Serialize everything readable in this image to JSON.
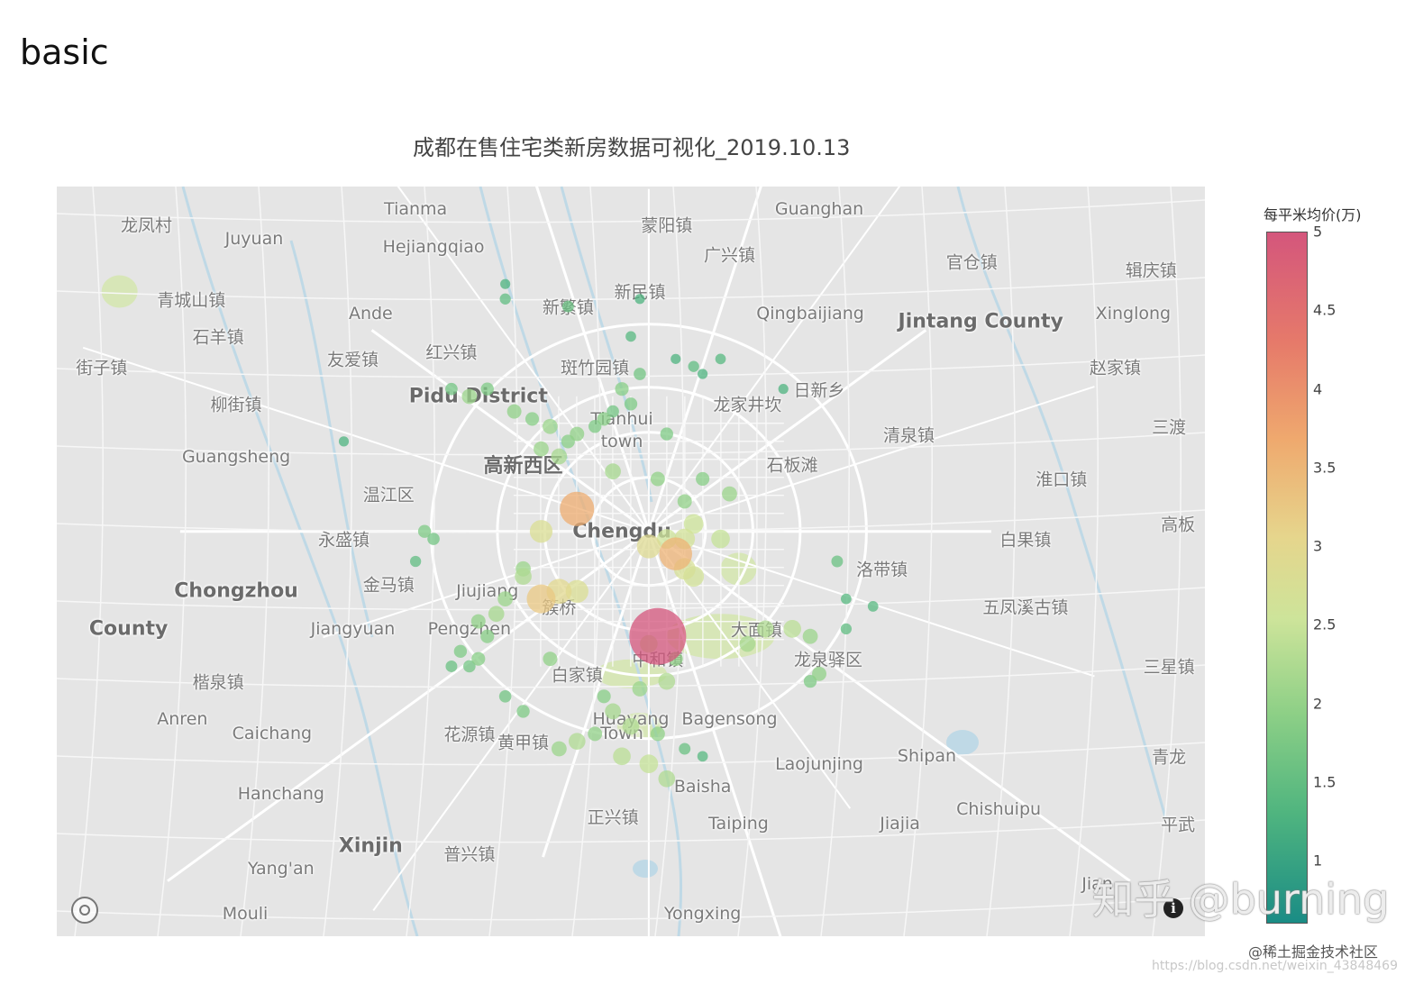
{
  "heading": "basic",
  "title": "成都在售住宅类新房数据可视化_2019.10.13",
  "colorbar": {
    "title": "每平米均价(万)",
    "ticks": [
      "5",
      "4.5",
      "4",
      "3.5",
      "3",
      "2.5",
      "2",
      "1.5",
      "1"
    ],
    "range": [
      0.6,
      5
    ],
    "colors": [
      "#1a8c85",
      "#50b57f",
      "#8ccf86",
      "#cde49a",
      "#e6d58c",
      "#efa96e",
      "#e67a6a",
      "#d4567c"
    ]
  },
  "places": [
    {
      "name": "Tianma",
      "lon": 103.8,
      "lat": 31.0
    },
    {
      "name": "Guanghan",
      "lon": 104.25,
      "lat": 31.0
    },
    {
      "name": "龙凤村",
      "lon": 103.5,
      "lat": 30.98
    },
    {
      "name": "Juyuan",
      "lon": 103.62,
      "lat": 30.96
    },
    {
      "name": "Hejiangqiao",
      "lon": 103.82,
      "lat": 30.95
    },
    {
      "name": "蒙阳镇",
      "lon": 104.08,
      "lat": 30.98
    },
    {
      "name": "广兴镇",
      "lon": 104.15,
      "lat": 30.94
    },
    {
      "name": "官仓镇",
      "lon": 104.42,
      "lat": 30.93
    },
    {
      "name": "辑庆镇",
      "lon": 104.62,
      "lat": 30.92
    },
    {
      "name": "青城山镇",
      "lon": 103.55,
      "lat": 30.88
    },
    {
      "name": "新民镇",
      "lon": 104.05,
      "lat": 30.89
    },
    {
      "name": "新繁镇",
      "lon": 103.97,
      "lat": 30.87
    },
    {
      "name": "Ande",
      "lon": 103.75,
      "lat": 30.86
    },
    {
      "name": "Qingbaijiang",
      "lon": 104.24,
      "lat": 30.86
    },
    {
      "name": "Jintang County",
      "lon": 104.43,
      "lat": 30.85,
      "major": true
    },
    {
      "name": "Xinglong",
      "lon": 104.6,
      "lat": 30.86
    },
    {
      "name": "石羊镇",
      "lon": 103.58,
      "lat": 30.83
    },
    {
      "name": "友爱镇",
      "lon": 103.73,
      "lat": 30.8
    },
    {
      "name": "红兴镇",
      "lon": 103.84,
      "lat": 30.81
    },
    {
      "name": "斑竹园镇",
      "lon": 104.0,
      "lat": 30.79
    },
    {
      "name": "街子镇",
      "lon": 103.45,
      "lat": 30.79
    },
    {
      "name": "赵家镇",
      "lon": 104.58,
      "lat": 30.79
    },
    {
      "name": "Pidu District",
      "lon": 103.87,
      "lat": 30.75,
      "major": true
    },
    {
      "name": "日新乡",
      "lon": 104.25,
      "lat": 30.76
    },
    {
      "name": "柳街镇",
      "lon": 103.6,
      "lat": 30.74
    },
    {
      "name": "龙家井坎",
      "lon": 104.17,
      "lat": 30.74
    },
    {
      "name": "Tianhui",
      "lon": 104.03,
      "lat": 30.72
    },
    {
      "name": "town",
      "lon": 104.03,
      "lat": 30.69
    },
    {
      "name": "清泉镇",
      "lon": 104.35,
      "lat": 30.7
    },
    {
      "name": "三渡",
      "lon": 104.64,
      "lat": 30.71
    },
    {
      "name": "Guangsheng",
      "lon": 103.6,
      "lat": 30.67
    },
    {
      "name": "高新西区",
      "lon": 103.92,
      "lat": 30.66,
      "major": true
    },
    {
      "name": "石板滩",
      "lon": 104.22,
      "lat": 30.66
    },
    {
      "name": "淮口镇",
      "lon": 104.52,
      "lat": 30.64
    },
    {
      "name": "温江区",
      "lon": 103.77,
      "lat": 30.62
    },
    {
      "name": "Chengdu",
      "lon": 104.03,
      "lat": 30.57,
      "major": true
    },
    {
      "name": "高板",
      "lon": 104.65,
      "lat": 30.58
    },
    {
      "name": "永盛镇",
      "lon": 103.72,
      "lat": 30.56
    },
    {
      "name": "白果镇",
      "lon": 104.48,
      "lat": 30.56
    },
    {
      "name": "洛带镇",
      "lon": 104.32,
      "lat": 30.52
    },
    {
      "name": "金马镇",
      "lon": 103.77,
      "lat": 30.5
    },
    {
      "name": "Chongzhou",
      "lon": 103.6,
      "lat": 30.49,
      "major": true
    },
    {
      "name": "Jiujiang",
      "lon": 103.88,
      "lat": 30.49
    },
    {
      "name": "簇桥",
      "lon": 103.96,
      "lat": 30.47
    },
    {
      "name": "五凤溪古镇",
      "lon": 104.48,
      "lat": 30.47
    },
    {
      "name": "County",
      "lon": 103.48,
      "lat": 30.44,
      "major": true
    },
    {
      "name": "Jiangyuan",
      "lon": 103.73,
      "lat": 30.44
    },
    {
      "name": "Pengzhen",
      "lon": 103.86,
      "lat": 30.44
    },
    {
      "name": "大面镇",
      "lon": 104.18,
      "lat": 30.44
    },
    {
      "name": "中和镇",
      "lon": 104.07,
      "lat": 30.4
    },
    {
      "name": "龙泉驿区",
      "lon": 104.26,
      "lat": 30.4
    },
    {
      "name": "白家镇",
      "lon": 103.98,
      "lat": 30.38
    },
    {
      "name": "三星镇",
      "lon": 104.64,
      "lat": 30.39
    },
    {
      "name": "楷泉镇",
      "lon": 103.58,
      "lat": 30.37
    },
    {
      "name": "Anren",
      "lon": 103.54,
      "lat": 30.32
    },
    {
      "name": "Caichang",
      "lon": 103.64,
      "lat": 30.3
    },
    {
      "name": "Huayang",
      "lon": 104.04,
      "lat": 30.32
    },
    {
      "name": "Bagensong",
      "lon": 104.15,
      "lat": 30.32
    },
    {
      "name": "花源镇",
      "lon": 103.86,
      "lat": 30.3
    },
    {
      "name": "黄甲镇",
      "lon": 103.92,
      "lat": 30.29
    },
    {
      "name": "Town",
      "lon": 104.03,
      "lat": 30.3
    },
    {
      "name": "青龙",
      "lon": 104.64,
      "lat": 30.27
    },
    {
      "name": "Laojunjing",
      "lon": 104.25,
      "lat": 30.26
    },
    {
      "name": "Shipan",
      "lon": 104.37,
      "lat": 30.27
    },
    {
      "name": "Baisha",
      "lon": 104.12,
      "lat": 30.23
    },
    {
      "name": "Hanchang",
      "lon": 103.65,
      "lat": 30.22
    },
    {
      "name": "Chishuipu",
      "lon": 104.45,
      "lat": 30.2
    },
    {
      "name": "正兴镇",
      "lon": 104.02,
      "lat": 30.19
    },
    {
      "name": "Taiping",
      "lon": 104.16,
      "lat": 30.18
    },
    {
      "name": "Jiajia",
      "lon": 104.34,
      "lat": 30.18
    },
    {
      "name": "平武",
      "lon": 104.65,
      "lat": 30.18
    },
    {
      "name": "Xinjin",
      "lon": 103.75,
      "lat": 30.15,
      "major": true
    },
    {
      "name": "普兴镇",
      "lon": 103.86,
      "lat": 30.14
    },
    {
      "name": "Yang'an",
      "lon": 103.65,
      "lat": 30.12
    },
    {
      "name": "Jian",
      "lon": 104.56,
      "lat": 30.1
    },
    {
      "name": "Mouli",
      "lon": 103.61,
      "lat": 30.06
    },
    {
      "name": "Yongxing",
      "lon": 104.12,
      "lat": 30.06
    }
  ],
  "chart_data": {
    "type": "scatter",
    "subtype": "scatter_mapbox",
    "title": "成都在售住宅类新房数据可视化_2019.10.13",
    "colorbar_title": "每平米均价(万)",
    "color_range": [
      0.6,
      5
    ],
    "lon_range": [
      103.4,
      104.68
    ],
    "lat_range": [
      30.03,
      31.03
    ],
    "points": [
      {
        "lon": 104.07,
        "lat": 30.43,
        "price": 5.0
      },
      {
        "lon": 103.9,
        "lat": 30.9,
        "price": 1.2
      },
      {
        "lon": 103.9,
        "lat": 30.88,
        "price": 1.4
      },
      {
        "lon": 104.05,
        "lat": 30.88,
        "price": 1.2
      },
      {
        "lon": 103.97,
        "lat": 30.87,
        "price": 1.5
      },
      {
        "lon": 104.04,
        "lat": 30.83,
        "price": 1.3
      },
      {
        "lon": 104.09,
        "lat": 30.8,
        "price": 1.2
      },
      {
        "lon": 104.11,
        "lat": 30.79,
        "price": 1.4
      },
      {
        "lon": 104.14,
        "lat": 30.8,
        "price": 1.3
      },
      {
        "lon": 104.12,
        "lat": 30.78,
        "price": 1.2
      },
      {
        "lon": 104.21,
        "lat": 30.76,
        "price": 1.2
      },
      {
        "lon": 104.05,
        "lat": 30.78,
        "price": 1.6
      },
      {
        "lon": 104.03,
        "lat": 30.76,
        "price": 1.8
      },
      {
        "lon": 104.04,
        "lat": 30.74,
        "price": 1.7
      },
      {
        "lon": 104.02,
        "lat": 30.73,
        "price": 1.6
      },
      {
        "lon": 104.01,
        "lat": 30.72,
        "price": 1.8
      },
      {
        "lon": 104.0,
        "lat": 30.71,
        "price": 1.7
      },
      {
        "lon": 103.98,
        "lat": 30.7,
        "price": 1.9
      },
      {
        "lon": 103.97,
        "lat": 30.69,
        "price": 1.8
      },
      {
        "lon": 104.08,
        "lat": 30.7,
        "price": 1.7
      },
      {
        "lon": 103.84,
        "lat": 30.76,
        "price": 1.6
      },
      {
        "lon": 103.88,
        "lat": 30.76,
        "price": 1.7
      },
      {
        "lon": 103.86,
        "lat": 30.75,
        "price": 2.0
      },
      {
        "lon": 103.91,
        "lat": 30.73,
        "price": 1.9
      },
      {
        "lon": 103.93,
        "lat": 30.72,
        "price": 1.8
      },
      {
        "lon": 103.95,
        "lat": 30.71,
        "price": 2.0
      },
      {
        "lon": 103.94,
        "lat": 30.68,
        "price": 2.0
      },
      {
        "lon": 103.96,
        "lat": 30.67,
        "price": 2.1
      },
      {
        "lon": 103.72,
        "lat": 30.69,
        "price": 1.2
      },
      {
        "lon": 104.02,
        "lat": 30.65,
        "price": 2.1
      },
      {
        "lon": 104.07,
        "lat": 30.64,
        "price": 1.9
      },
      {
        "lon": 104.12,
        "lat": 30.64,
        "price": 1.8
      },
      {
        "lon": 104.1,
        "lat": 30.61,
        "price": 1.9
      },
      {
        "lon": 104.15,
        "lat": 30.62,
        "price": 2.0
      },
      {
        "lon": 103.98,
        "lat": 30.6,
        "price": 3.7
      },
      {
        "lon": 103.94,
        "lat": 30.57,
        "price": 2.8
      },
      {
        "lon": 104.1,
        "lat": 30.56,
        "price": 2.6
      },
      {
        "lon": 104.11,
        "lat": 30.58,
        "price": 2.5
      },
      {
        "lon": 104.08,
        "lat": 30.56,
        "price": 2.5
      },
      {
        "lon": 104.09,
        "lat": 30.54,
        "price": 3.6
      },
      {
        "lon": 104.06,
        "lat": 30.55,
        "price": 2.9
      },
      {
        "lon": 104.14,
        "lat": 30.56,
        "price": 2.4
      },
      {
        "lon": 104.1,
        "lat": 30.52,
        "price": 2.7
      },
      {
        "lon": 104.11,
        "lat": 30.51,
        "price": 2.6
      },
      {
        "lon": 103.94,
        "lat": 30.48,
        "price": 3.3
      },
      {
        "lon": 103.96,
        "lat": 30.49,
        "price": 3.0
      },
      {
        "lon": 103.98,
        "lat": 30.49,
        "price": 2.8
      },
      {
        "lon": 103.92,
        "lat": 30.51,
        "price": 2.2
      },
      {
        "lon": 103.9,
        "lat": 30.48,
        "price": 2.0
      },
      {
        "lon": 103.89,
        "lat": 30.46,
        "price": 2.1
      },
      {
        "lon": 103.87,
        "lat": 30.45,
        "price": 1.9
      },
      {
        "lon": 103.88,
        "lat": 30.43,
        "price": 1.8
      },
      {
        "lon": 103.85,
        "lat": 30.41,
        "price": 1.7
      },
      {
        "lon": 103.87,
        "lat": 30.4,
        "price": 1.8
      },
      {
        "lon": 103.86,
        "lat": 30.39,
        "price": 1.6
      },
      {
        "lon": 103.84,
        "lat": 30.39,
        "price": 1.5
      },
      {
        "lon": 103.81,
        "lat": 30.57,
        "price": 1.7
      },
      {
        "lon": 103.82,
        "lat": 30.56,
        "price": 1.6
      },
      {
        "lon": 103.8,
        "lat": 30.53,
        "price": 1.4
      },
      {
        "lon": 103.92,
        "lat": 30.52,
        "price": 2.0
      },
      {
        "lon": 104.06,
        "lat": 30.42,
        "price": 2.3
      },
      {
        "lon": 104.09,
        "lat": 30.4,
        "price": 1.9
      },
      {
        "lon": 104.08,
        "lat": 30.37,
        "price": 2.2
      },
      {
        "lon": 104.05,
        "lat": 30.36,
        "price": 2.0
      },
      {
        "lon": 104.02,
        "lat": 30.33,
        "price": 2.1
      },
      {
        "lon": 104.04,
        "lat": 30.31,
        "price": 2.2
      },
      {
        "lon": 104.0,
        "lat": 30.3,
        "price": 1.9
      },
      {
        "lon": 103.98,
        "lat": 30.29,
        "price": 2.2
      },
      {
        "lon": 103.96,
        "lat": 30.28,
        "price": 2.0
      },
      {
        "lon": 104.07,
        "lat": 30.3,
        "price": 1.9
      },
      {
        "lon": 104.1,
        "lat": 30.28,
        "price": 1.5
      },
      {
        "lon": 104.12,
        "lat": 30.27,
        "price": 1.3
      },
      {
        "lon": 104.03,
        "lat": 30.27,
        "price": 2.3
      },
      {
        "lon": 104.06,
        "lat": 30.26,
        "price": 2.4
      },
      {
        "lon": 104.08,
        "lat": 30.24,
        "price": 2.2
      },
      {
        "lon": 104.19,
        "lat": 30.44,
        "price": 2.2
      },
      {
        "lon": 104.22,
        "lat": 30.44,
        "price": 2.3
      },
      {
        "lon": 104.24,
        "lat": 30.43,
        "price": 2.0
      },
      {
        "lon": 104.17,
        "lat": 30.42,
        "price": 2.1
      },
      {
        "lon": 104.25,
        "lat": 30.38,
        "price": 1.9
      },
      {
        "lon": 104.24,
        "lat": 30.37,
        "price": 1.7
      },
      {
        "lon": 104.28,
        "lat": 30.48,
        "price": 1.3
      },
      {
        "lon": 104.31,
        "lat": 30.47,
        "price": 1.3
      },
      {
        "lon": 104.28,
        "lat": 30.44,
        "price": 1.4
      },
      {
        "lon": 104.27,
        "lat": 30.53,
        "price": 1.5
      },
      {
        "lon": 103.92,
        "lat": 30.33,
        "price": 1.7
      },
      {
        "lon": 103.9,
        "lat": 30.35,
        "price": 1.6
      },
      {
        "lon": 103.95,
        "lat": 30.4,
        "price": 1.9
      },
      {
        "lon": 104.01,
        "lat": 30.35,
        "price": 1.8
      }
    ]
  },
  "watermark": "知乎 @burning",
  "footer": {
    "line1": "@稀土掘金技术社区",
    "line2": "https://blog.csdn.net/weixin_43848469"
  },
  "icons": {
    "mapbox_logo": "mapbox-logo-icon",
    "info": "info-icon"
  }
}
